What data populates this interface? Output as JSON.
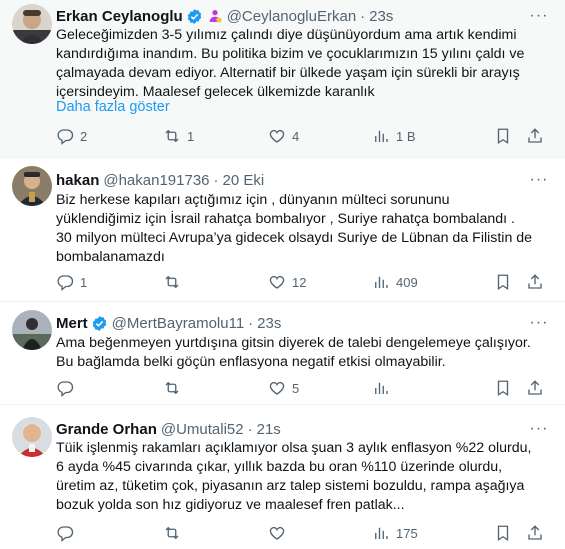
{
  "tweets": [
    {
      "name": "Erkan Ceylanoglu",
      "handle": "@CeylanogluErkan",
      "time": "23s",
      "verified": true,
      "affiliate": true,
      "lines": [
        "Geleceğimizden 3-5 yılımız çalındı diye düşünüyordum ama artık kendimi",
        "kandırdığıma inandım. Bu politika bizim ve çocuklarımızın 15 yılını çaldı ve",
        "çalmayada devam ediyor. Alternatif bir ülkede yaşam için sürekli bir arayış",
        "içersindeyim. Maalesef gelecek ülkemizde karanlık"
      ],
      "show_more": "Daha fazla göster",
      "replies": "2",
      "retweets": "1",
      "likes": "4",
      "views": "1 B"
    },
    {
      "name": "hakan",
      "handle": "@hakan191736",
      "time": "20 Eki",
      "verified": false,
      "lines": [
        "Biz herkese kapıları açtığımız için , dünyanın mülteci sorununu",
        "yüklendiğimiz için İsrail rahatça bombalıyor , Suriye rahatça bombalandı .",
        "30 milyon mülteci Avrupa’ya gidecek olsaydı Suriye de Lübnan da Filistin de",
        "bombalanamazdı"
      ],
      "replies": "1",
      "retweets": "",
      "likes": "12",
      "views": "409"
    },
    {
      "name": "Mert",
      "handle": "@MertBayramolu11",
      "time": "23s",
      "verified": true,
      "lines": [
        "Ama beğenmeyen yurtdışına gitsin diyerek de talebi dengelemeye çalışıyor.",
        "Bu bağlamda belki göçün enflasyona negatif etkisi olmayabilir."
      ],
      "replies": "",
      "retweets": "",
      "likes": "5",
      "views": ""
    },
    {
      "name": "Grande Orhan",
      "handle": "@Umutali52",
      "time": "21s",
      "verified": false,
      "lines": [
        "Tüik işlenmiş rakamları açıklamıyor olsa şuan 3 aylık enflasyon %22 olurdu,",
        "6 ayda %45 civarında çıkar, yıllık bazda bu oran %110 üzerinde olurdu,",
        "üretim az, tüketim çok, piyasanın arz talep sistemi bozuldu, rampa aşağıya",
        "bozuk yolda son hız gidiyoruz ve maalesef fren patlak..."
      ],
      "replies": "",
      "retweets": "",
      "likes": "",
      "views": "175"
    }
  ],
  "more_label": "···",
  "colors": {
    "accent": "#1d9bf0",
    "secondary": "#536471",
    "affiliate": "#c13ae1"
  },
  "icons": [
    "reply-icon",
    "retweet-icon",
    "like-icon",
    "views-icon",
    "bookmark-icon",
    "share-icon",
    "verified-icon",
    "more-icon"
  ]
}
